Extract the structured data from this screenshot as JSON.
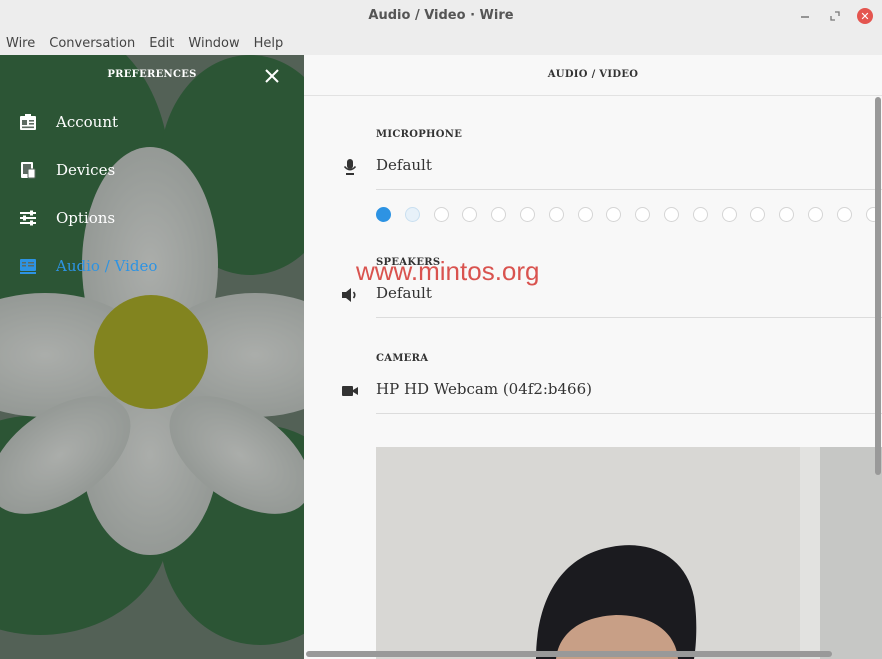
{
  "window": {
    "title": "Audio / Video · Wire",
    "controls": {
      "minimize": "–",
      "restore": "⤡",
      "close": "✕"
    }
  },
  "menu": [
    "Wire",
    "Conversation",
    "Edit",
    "Window",
    "Help"
  ],
  "sidebar": {
    "title": "PREFERENCES",
    "items": [
      {
        "label": "Account",
        "icon": "account-card-icon",
        "active": false
      },
      {
        "label": "Devices",
        "icon": "devices-icon",
        "active": false
      },
      {
        "label": "Options",
        "icon": "sliders-icon",
        "active": false
      },
      {
        "label": "Audio / Video",
        "icon": "audio-video-icon",
        "active": true
      }
    ]
  },
  "main": {
    "title": "AUDIO / VIDEO",
    "microphone": {
      "label": "MICROPHONE",
      "value": "Default",
      "level_dots_on": 1,
      "level_dots_half": 1
    },
    "speakers": {
      "label": "SPEAKERS",
      "value": "Default"
    },
    "camera": {
      "label": "CAMERA",
      "value": "HP HD Webcam (04f2:b466)"
    }
  },
  "watermark": "www.mintos.org",
  "colors": {
    "accent": "#2d93e3",
    "close_button": "#e4554f",
    "watermark": "#d9534f"
  }
}
